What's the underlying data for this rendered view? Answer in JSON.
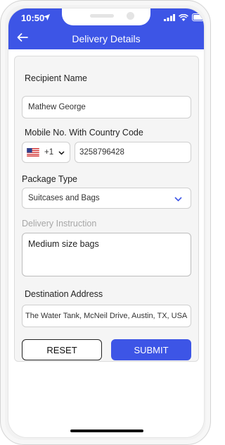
{
  "status_bar": {
    "time": "10:50"
  },
  "header": {
    "title": "Delivery Details"
  },
  "form": {
    "recipient_name": {
      "label": "Recipient Name",
      "value": "Mathew George"
    },
    "mobile": {
      "label": "Mobile No. With Country Code",
      "country_code": "+1",
      "number": "3258796428"
    },
    "package_type": {
      "label": "Package Type",
      "value": "Suitcases and Bags"
    },
    "delivery_instruction": {
      "label": "Delivery Instruction",
      "value": "Medium size bags"
    },
    "destination": {
      "label": "Destination Address",
      "value": "The Water Tank, McNeil Drive, Austin, TX, USA"
    }
  },
  "buttons": {
    "reset": "RESET",
    "submit": "SUBMIT"
  },
  "colors": {
    "accent": "#3d55e6",
    "background": "#ffffff",
    "card": "#f5f5f5"
  },
  "icons": [
    "location-arrow-icon",
    "signal-icon",
    "wifi-icon",
    "battery-icon",
    "back-arrow-icon",
    "us-flag-icon",
    "chevron-down-icon"
  ]
}
